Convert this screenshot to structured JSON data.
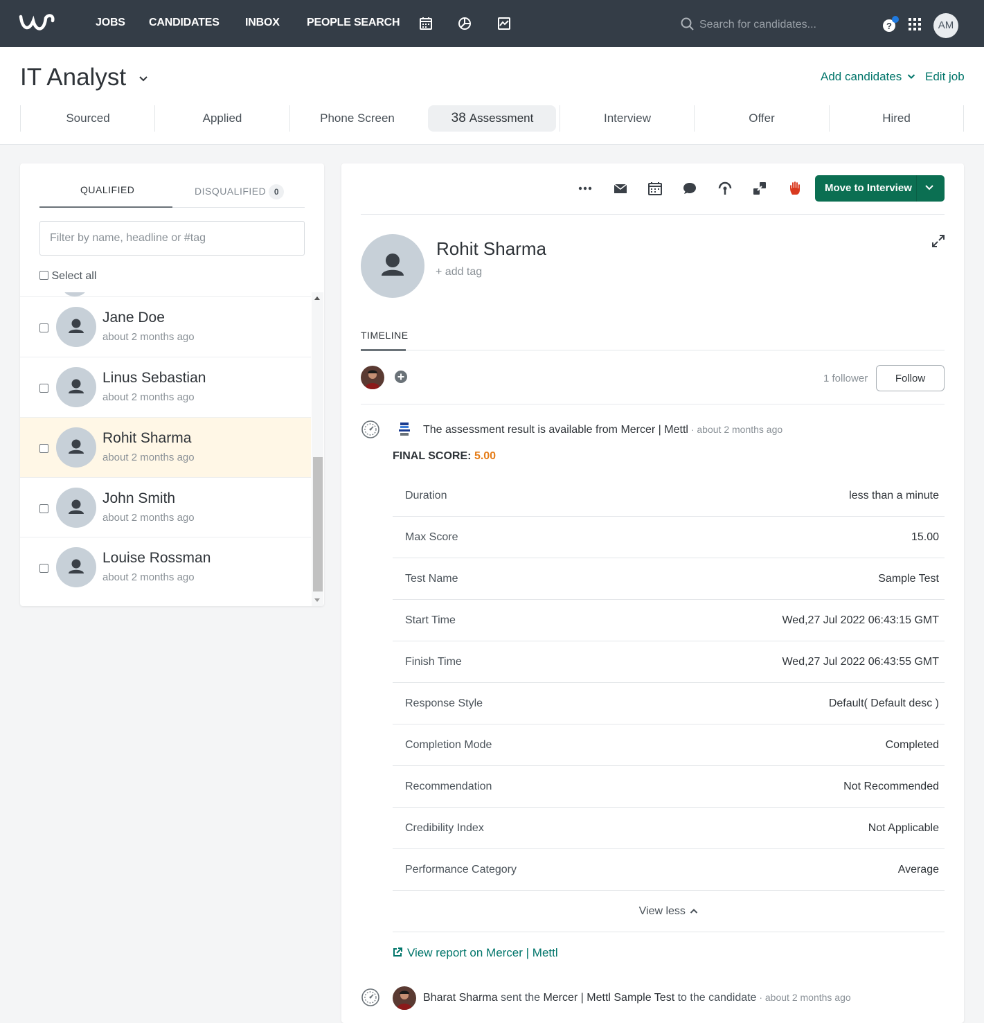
{
  "nav": {
    "links": [
      "JOBS",
      "CANDIDATES",
      "INBOX",
      "PEOPLE SEARCH"
    ],
    "search_placeholder": "Search for candidates...",
    "user_initials": "AM",
    "notification_dot_color": "#1f7ae0"
  },
  "job": {
    "title": "IT Analyst",
    "add_candidates": "Add candidates",
    "edit_job": "Edit job",
    "stages": [
      {
        "label": "Sourced",
        "count": ""
      },
      {
        "label": "Applied",
        "count": ""
      },
      {
        "label": "Phone Screen",
        "count": ""
      },
      {
        "label": "Assessment",
        "count": "38"
      },
      {
        "label": "Interview",
        "count": ""
      },
      {
        "label": "Offer",
        "count": ""
      },
      {
        "label": "Hired",
        "count": ""
      }
    ]
  },
  "left": {
    "tab_qualified": "QUALIFIED",
    "tab_disqualified": "DISQUALIFIED",
    "disqualified_count": "0",
    "filter_placeholder": "Filter by name, headline or #tag",
    "select_all": "Select all",
    "candidates": [
      {
        "name": "Jane Doe",
        "ago": "about 2 months ago"
      },
      {
        "name": "Linus Sebastian",
        "ago": "about 2 months ago"
      },
      {
        "name": "Rohit Sharma",
        "ago": "about 2 months ago",
        "selected": true
      },
      {
        "name": "John Smith",
        "ago": "about 2 months ago"
      },
      {
        "name": "Louise Rossman",
        "ago": "about 2 months ago"
      }
    ]
  },
  "detail": {
    "move_button": "Move to Interview",
    "brand_color": "#0b6f52",
    "candidate_name": "Rohit Sharma",
    "add_tag": "+ add tag",
    "timeline_tab": "TIMELINE",
    "follower_count": "1 follower",
    "follow_button": "Follow",
    "event1": {
      "text": "The assessment result is available from Mercer | Mettl",
      "time": " · about 2 months ago",
      "final_score_label": "FINAL SCORE:",
      "final_score": "5.00"
    },
    "rows": [
      {
        "k": "Duration",
        "v": "less than a minute"
      },
      {
        "k": "Max Score",
        "v": "15.00"
      },
      {
        "k": "Test Name",
        "v": "Sample Test"
      },
      {
        "k": "Start Time",
        "v": "Wed,27 Jul 2022 06:43:15 GMT"
      },
      {
        "k": "Finish Time",
        "v": "Wed,27 Jul 2022 06:43:55 GMT"
      },
      {
        "k": "Response Style",
        "v": "Default( Default desc )"
      },
      {
        "k": "Completion Mode",
        "v": "Completed"
      },
      {
        "k": "Recommendation",
        "v": "Not Recommended"
      },
      {
        "k": "Credibility Index",
        "v": "Not Applicable"
      },
      {
        "k": "Performance Category",
        "v": "Average"
      }
    ],
    "view_less": "View less",
    "view_report": "View report on Mercer | Mettl",
    "event2": {
      "actor": "Bharat Sharma",
      "verb": " sent the ",
      "object": "Mercer | Mettl Sample Test",
      "rest": " to the candidate",
      "time": " · about 2 months ago"
    }
  }
}
